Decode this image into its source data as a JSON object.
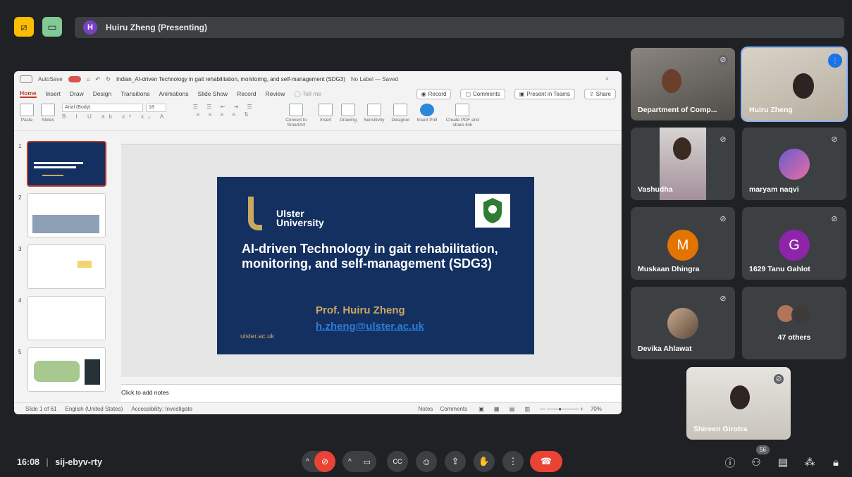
{
  "presenter": {
    "initial": "H",
    "label": "Huiru Zheng (Presenting)"
  },
  "ppt": {
    "autosave": "AutoSave",
    "filename": "Indian_AI-driven Technology in gait rehabilitation, monitoring, and self-management (SDG3)",
    "label_status": "No Label — Saved",
    "tabs": [
      "Home",
      "Insert",
      "Draw",
      "Design",
      "Transitions",
      "Animations",
      "Slide Show",
      "Record",
      "Review"
    ],
    "tell_me": "Tell me",
    "record_btn": "Record",
    "comments_btn": "Comments",
    "present_teams_btn": "Present in Teams",
    "share_btn": "Share",
    "font_name": "Arial (Body)",
    "font_size": "18",
    "ribbon_labels": {
      "paste": "Paste",
      "slides": "Slides",
      "convert": "Convert to SmartArt",
      "insert": "Insert",
      "drawing": "Drawing",
      "sensitivity": "Sensitivity",
      "designer": "Designer",
      "insert_poll": "Insert Poll",
      "create_pdf": "Create PDF and share link"
    },
    "slide_nums": [
      "1",
      "2",
      "3",
      "4",
      "5"
    ],
    "notes_placeholder": "Click to add notes",
    "status": {
      "slide": "Slide 1 of 61",
      "language": "English (United States)",
      "accessibility": "Accessibility: Investigate",
      "notes": "Notes",
      "comments": "Comments",
      "zoom": "70%"
    }
  },
  "slide": {
    "brand_line1": "Ulster",
    "brand_line2": "University",
    "title": "AI-driven Technology in gait rehabilitation, monitoring, and self-management (SDG3)",
    "author": "Prof. Huiru Zheng",
    "email": "h.zheng@ulster.ac.uk",
    "url": "ulster.ac.uk"
  },
  "participants": {
    "dept": "Department of Comp...",
    "huiru": "Huiru Zheng",
    "vashudha": "Vashudha",
    "maryam": "maryam naqvi",
    "muskaan": "Muskaan Dhingra",
    "muskaan_initial": "M",
    "tanu": "1629 Tanu Gahlot",
    "tanu_initial": "G",
    "devika": "Devika Ahlawat",
    "others": "47 others",
    "shireen": "Shireen Girotra"
  },
  "meeting": {
    "time": "16:08",
    "code": "sij-ebyv-rty",
    "people_count": "56"
  },
  "colors": {
    "bg": "#202124",
    "tile": "#3c4043",
    "end_call": "#ea4335",
    "muskaan": "#e37400",
    "tanu": "#8e24aa",
    "speaking": "#8ab4f8"
  }
}
